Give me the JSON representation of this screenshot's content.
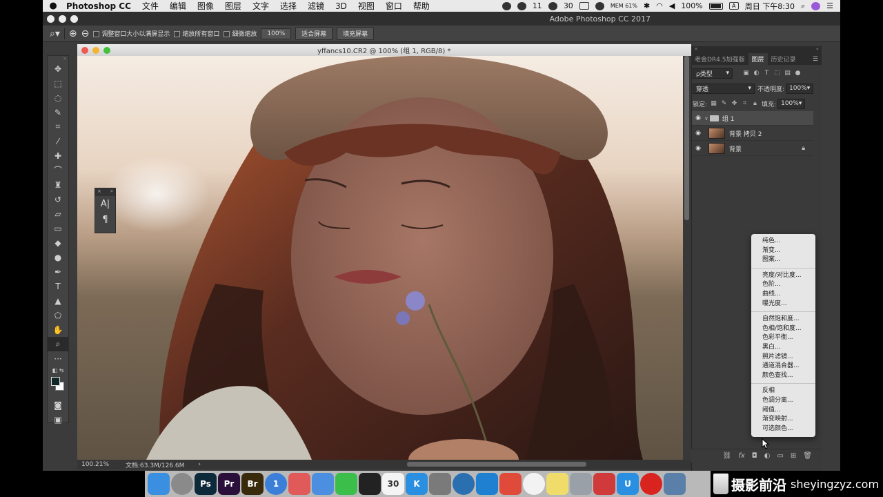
{
  "menubar": {
    "app": "Photoshop CC",
    "items": [
      "文件",
      "编辑",
      "图像",
      "图层",
      "文字",
      "选择",
      "滤镜",
      "3D",
      "视图",
      "窗口",
      "帮助"
    ],
    "tray": {
      "badge_count": "11",
      "num": "30",
      "cpu": "MEM 61%",
      "battery": "100%",
      "input": "A",
      "clock": "周日 下午8:30"
    }
  },
  "app_title": "Adobe Photoshop CC 2017",
  "options_bar": {
    "resize_windows": "调整窗口大小以满屏显示",
    "zoom_all_windows": "缩放所有窗口",
    "scrubby_zoom": "细微缩放",
    "zoom_value": "100%",
    "fit_screen": "适合屏幕",
    "fill_screen": "填充屏幕"
  },
  "document": {
    "title": "yffancs10.CR2 @ 100% (组 1, RGB/8) *",
    "zoom": "100.21%",
    "doc_size": "文档:63.3M/126.6M"
  },
  "char_panel": {
    "icon1": "A|",
    "icon2": "¶"
  },
  "right_panel": {
    "tabs": [
      "老金DR4.5加强版",
      "图层",
      "历史记录"
    ],
    "filter_kind": "ρ类型",
    "blend_mode": "穿透",
    "opacity_label": "不透明度:",
    "opacity_value": "100%",
    "lock_label": "锁定:",
    "fill_label": "填充:",
    "fill_value": "100%",
    "layers": [
      {
        "name": "组 1",
        "type": "group"
      },
      {
        "name": "背景 拷贝 2",
        "type": "layer"
      },
      {
        "name": "背景",
        "type": "background"
      }
    ]
  },
  "adjustment_menu": [
    [
      "纯色...",
      "渐变...",
      "图案..."
    ],
    [
      "亮度/对比度...",
      "色阶...",
      "曲线...",
      "曝光度..."
    ],
    [
      "自然饱和度...",
      "色相/饱和度...",
      "色彩平衡...",
      "黑白...",
      "照片滤镜...",
      "通道混合器...",
      "颜色查找..."
    ],
    [
      "反相",
      "色调分离...",
      "阈值...",
      "渐变映射...",
      "可选颜色..."
    ]
  ],
  "dock": {
    "apps": [
      {
        "label": "",
        "color": "#3b8fe0",
        "icon": "finder-icon"
      },
      {
        "label": "",
        "color": "#8a8a8a",
        "icon": "launchpad-icon"
      },
      {
        "label": "Ps",
        "color": "#0c2a3a",
        "icon": "photoshop-icon"
      },
      {
        "label": "Pr",
        "color": "#2a0f3a",
        "icon": "premiere-icon"
      },
      {
        "label": "Br",
        "color": "#3a2a0c",
        "icon": "bridge-icon"
      },
      {
        "label": "1",
        "color": "#3b7fd8",
        "icon": "onepassword-icon"
      },
      {
        "label": "",
        "color": "#e05a5a",
        "icon": "affinity-icon"
      },
      {
        "label": "",
        "color": "#4c8ee0",
        "icon": "baidu-icon"
      },
      {
        "label": "",
        "color": "#3cbf4a",
        "icon": "wechat-icon"
      },
      {
        "label": "",
        "color": "#222222",
        "icon": "qq-icon"
      },
      {
        "label": "30",
        "color": "#f4f4f4",
        "icon": "calendar-icon"
      },
      {
        "label": "K",
        "color": "#2a8fe0",
        "icon": "kugou-icon"
      },
      {
        "label": "",
        "color": "#7a7a7a",
        "icon": "system-prefs-icon"
      },
      {
        "label": "",
        "color": "#2a6fb0",
        "icon": "quicktime-icon"
      },
      {
        "label": "",
        "color": "#1f7fd0",
        "icon": "mindnode-icon"
      },
      {
        "label": "",
        "color": "#e04a3a",
        "icon": "mail-icon"
      },
      {
        "label": "",
        "color": "#f2f2f2",
        "icon": "chrome-icon"
      },
      {
        "label": "",
        "color": "#f0dc6a",
        "icon": "notes-icon"
      },
      {
        "label": "",
        "color": "#9aa0a8",
        "icon": "utilities-icon"
      },
      {
        "label": "",
        "color": "#d03a3a",
        "icon": "screen-recorder-icon"
      },
      {
        "label": "U",
        "color": "#2a8fe0",
        "icon": "u-app-icon"
      },
      {
        "label": "",
        "color": "#d8231f",
        "icon": "netease-music-icon"
      },
      {
        "label": "",
        "color": "#5a7fa8",
        "icon": "preview-icon"
      }
    ]
  },
  "watermark": {
    "cn": "摄影前沿",
    "url": "sheyingzyz.com"
  }
}
